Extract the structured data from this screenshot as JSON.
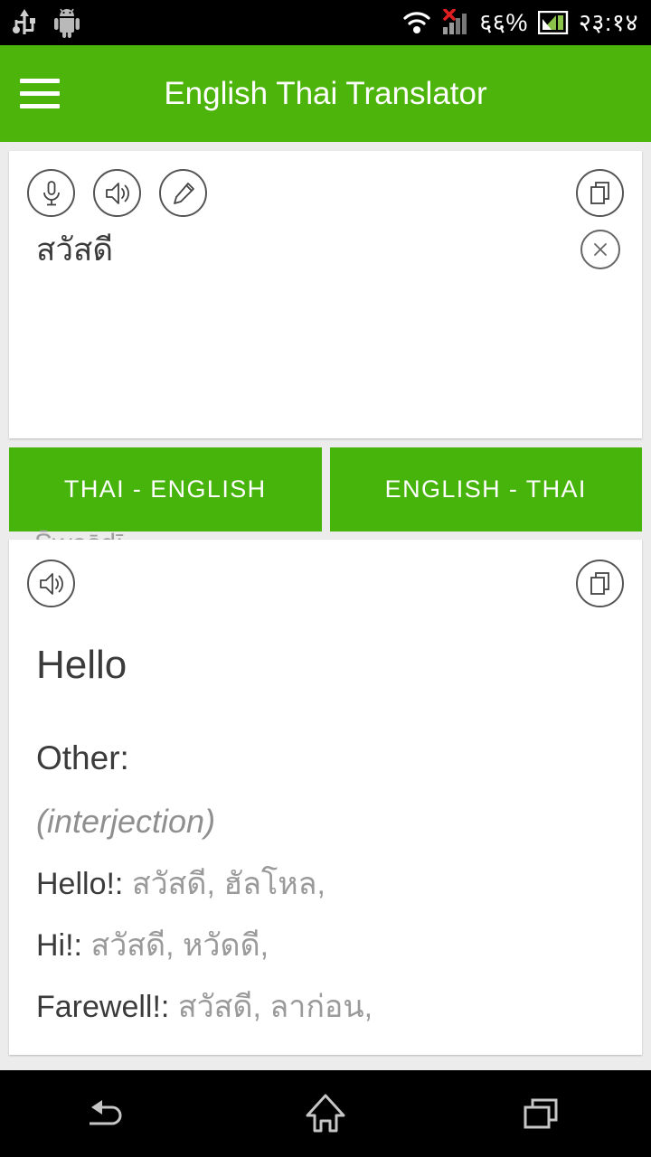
{
  "statusbar": {
    "battery": "६६%",
    "time": "२३:१४",
    "icons": [
      "usb-icon",
      "android-icon",
      "wifi-icon",
      "signal-icon",
      "battery-icon"
    ]
  },
  "appbar": {
    "title": "English Thai Translator",
    "menu_icon": "hamburger-menu-icon",
    "bg_color": "#4CB40A"
  },
  "input_card": {
    "mic_icon": "microphone-icon",
    "speak_icon": "speaker-icon",
    "edit_icon": "pencil-icon",
    "copy_icon": "copy-icon",
    "clear_icon": "close-icon",
    "source_text": "สวัสดี",
    "transliteration": "S̄wạs̄dī"
  },
  "direction": {
    "thai_english": "THAI - ENGLISH",
    "english_thai": "ENGLISH - THAI"
  },
  "result_card": {
    "speak_icon": "speaker-icon",
    "copy_icon": "copy-icon",
    "translation": "Hello",
    "other_label": "Other:",
    "part_of_speech": "(interjection)",
    "entries": [
      {
        "label": "Hello!:",
        "values": "สวัสดี, ฮัลโหล,"
      },
      {
        "label": "Hi!:",
        "values": "สวัสดี, หวัดดี,"
      },
      {
        "label": "Farewell!:",
        "values": "สวัสดี, ลาก่อน,"
      }
    ]
  },
  "navbar": {
    "back_icon": "back-arrow-icon",
    "home_icon": "home-icon",
    "recents_icon": "recents-icon"
  }
}
